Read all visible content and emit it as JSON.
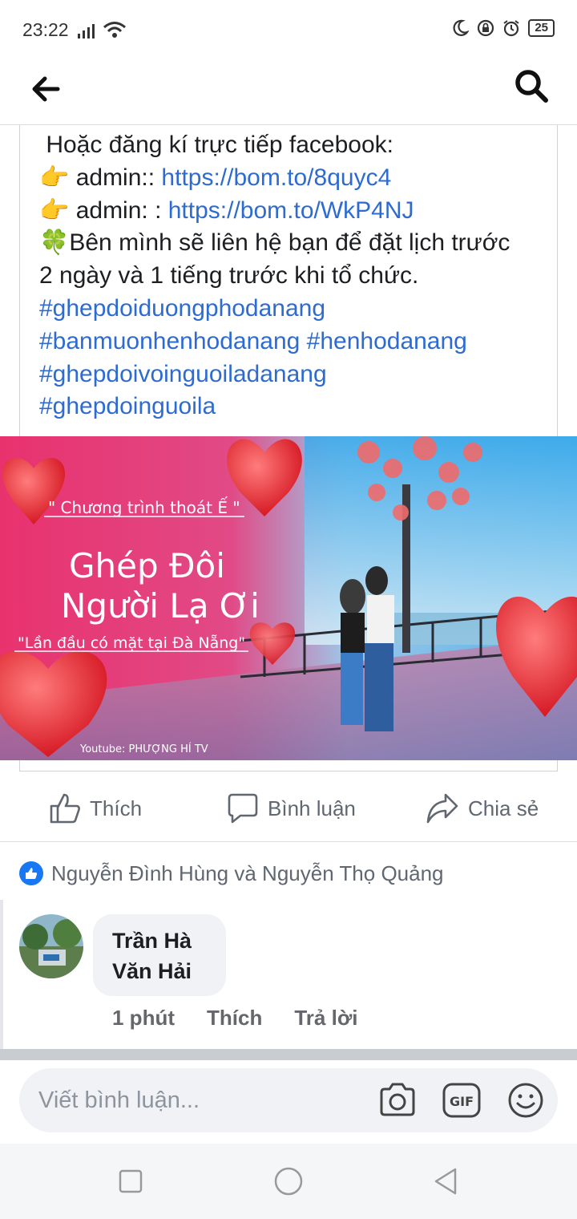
{
  "status_bar": {
    "time": "23:22",
    "battery": "25",
    "icons": [
      "signal-icon",
      "wifi-icon",
      "moon-icon",
      "lock-rotation-icon",
      "alarm-icon",
      "battery-icon"
    ]
  },
  "nav": {
    "back_icon": "arrow-left-icon",
    "search_icon": "search-icon"
  },
  "post": {
    "lines": [
      {
        "text": " Hoặc đăng kí trực tiếp facebook:"
      },
      {
        "prefix_emoji": "👉",
        "text": " admin:: ",
        "link": "https://bom.to/8quyc4"
      },
      {
        "prefix_emoji": "👉",
        "text": " admin: : ",
        "link": "https://bom.to/WkP4NJ"
      },
      {
        "prefix_emoji": "🍀",
        "text": "Bên mình sẽ liên hệ bạn để đặt lịch trước"
      },
      {
        "text": "2 ngày và 1 tiếng trước khi tổ chức."
      }
    ],
    "hashtags_lines": [
      "#ghepdoiduongphodanang",
      "#banmuonhenhodanang #henhodanang",
      "#ghepdoivoinguoiladanang",
      "#ghepdoinguoila"
    ],
    "image": {
      "top_caption": "\" Chương trình thoát Ế \"",
      "title_line1": "Ghép Đôi",
      "title_line2": "Người Lạ Ơi",
      "bottom_caption": "\"Lần đầu có mặt tại Đà Nẵng\"",
      "credit": "Youtube: PHƯỢNG HÍ TV"
    }
  },
  "actions": {
    "like": "Thích",
    "comment": "Bình luận",
    "share": "Chia sẻ"
  },
  "reactions": {
    "names": "Nguyễn Đình Hùng và Nguyễn Thọ Quảng"
  },
  "comment": {
    "author_line1": "Trần Hà",
    "author_line2": "Văn Hải",
    "time": "1 phút",
    "like": "Thích",
    "reply": "Trả lời"
  },
  "composer": {
    "placeholder": "Viết bình luận...",
    "icons": [
      "camera-icon",
      "gif-icon",
      "emoji-icon"
    ]
  },
  "system_nav": {
    "icons": [
      "recent-apps-icon",
      "home-icon",
      "back-triangle-icon"
    ]
  },
  "colors": {
    "link": "#2e6bd1",
    "facebook_blue": "#1877f2",
    "muted_text": "#606770"
  }
}
